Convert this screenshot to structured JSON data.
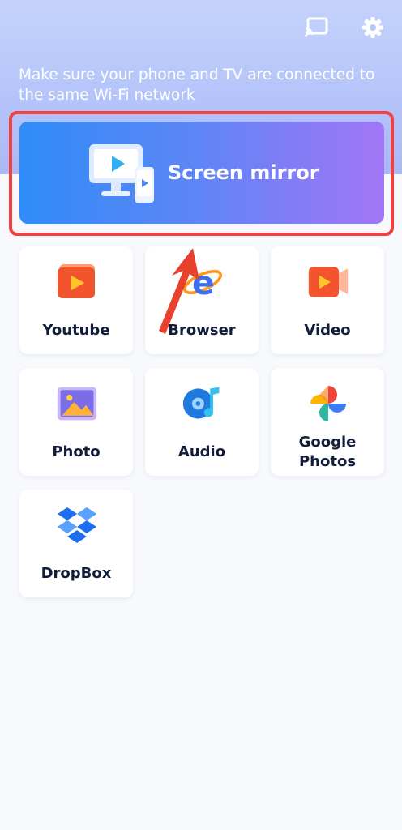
{
  "header": {
    "notice": "Make sure your phone and TV are connected to the same Wi-Fi network",
    "cast_icon": "cast-icon",
    "settings_icon": "gear-icon"
  },
  "mirror": {
    "label": "Screen mirror",
    "icon": "monitor-phone-icon"
  },
  "tiles": [
    {
      "label": "Youtube",
      "icon": "youtube-icon"
    },
    {
      "label": "Browser",
      "icon": "browser-icon"
    },
    {
      "label": "Video",
      "icon": "video-icon"
    },
    {
      "label": "Photo",
      "icon": "photo-icon"
    },
    {
      "label": "Audio",
      "icon": "audio-icon"
    },
    {
      "label": "Google\nPhotos",
      "icon": "google-photos-icon"
    },
    {
      "label": "DropBox",
      "icon": "dropbox-icon"
    }
  ],
  "colors": {
    "highlight": "#f04040",
    "mirror_start": "#2f8cf8",
    "mirror_end": "#a276f6",
    "label": "#111d3a"
  }
}
